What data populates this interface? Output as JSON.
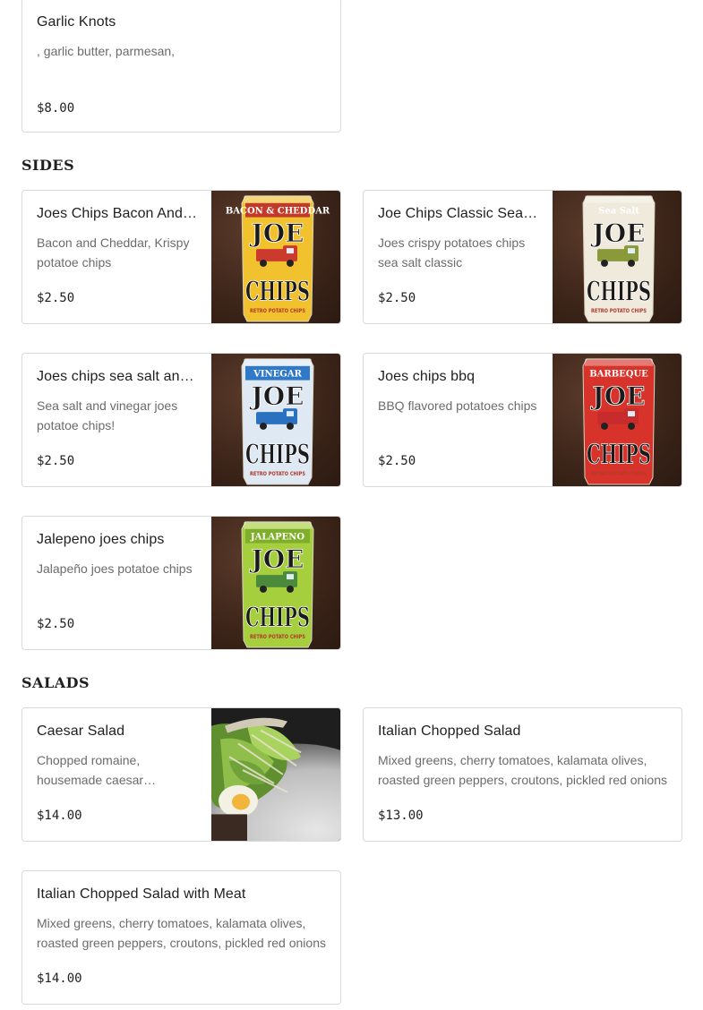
{
  "top_item": {
    "name": "Garlic Knots",
    "description": ", garlic butter, parmesan,",
    "price": "$8.00"
  },
  "sides": {
    "title": "SIDES",
    "items": [
      {
        "name": "Joes Chips Bacon And Cheddar",
        "description": "Bacon and Cheddar, Krispy potatoe chips",
        "price": "$2.50",
        "image": {
          "bag_color": "#f2c12e",
          "band_text": "BACON & CHEDDAR",
          "band_color": "#c23a2a",
          "truck_color": "#cc3a2e"
        }
      },
      {
        "name": "Joe Chips Classic Sea Salt",
        "description": "Joes crispy potatoes chips sea salt classic",
        "price": "$2.50",
        "image": {
          "bag_color": "#efeadb",
          "band_text": "Sea Salt",
          "band_color": "#efeadb",
          "truck_color": "#8a9a3a"
        }
      },
      {
        "name": "Joes chips sea salt and vinegar",
        "description": "Sea salt and vinegar joes potatoe chips!",
        "price": "$2.50",
        "image": {
          "bag_color": "#dfe9f3",
          "band_text": "VINEGAR",
          "band_color": "#2f79c8",
          "truck_color": "#2a72c0"
        }
      },
      {
        "name": "Joes chips bbq",
        "description": "BBQ flavored potatoes chips",
        "price": "$2.50",
        "image": {
          "bag_color": "#d8332a",
          "band_text": "BARBEQUE",
          "band_color": "#d8332a",
          "truck_color": "#c72b2b"
        }
      },
      {
        "name": "Jalepeno joes chips",
        "description": "Jalapeño joes potatoe chips",
        "price": "$2.50",
        "image": {
          "bag_color": "#a6cf3e",
          "band_text": "JALAPENO",
          "band_color": "#7fae2a",
          "truck_color": "#4a8a3a"
        }
      }
    ]
  },
  "salads": {
    "title": "SALADS",
    "items": [
      {
        "name": "Caesar Salad",
        "description": "Chopped romaine, housemade caesar dressing, parmesan, croutons, anchovies",
        "price": "$14.00"
      },
      {
        "name": "Italian Chopped Salad",
        "description": "Mixed greens, cherry tomatoes, kalamata olives, roasted green peppers, croutons, pickled red onions",
        "price": "$13.00"
      },
      {
        "name": "Italian Chopped Salad with Meat",
        "description": "Mixed greens, cherry tomatoes, kalamata olives, roasted green peppers, croutons, pickled red onions",
        "price": "$14.00"
      }
    ]
  },
  "chips_logo": {
    "top": "JOE",
    "bottom": "CHIPS",
    "tagline": "RETRO POTATO CHIPS"
  }
}
